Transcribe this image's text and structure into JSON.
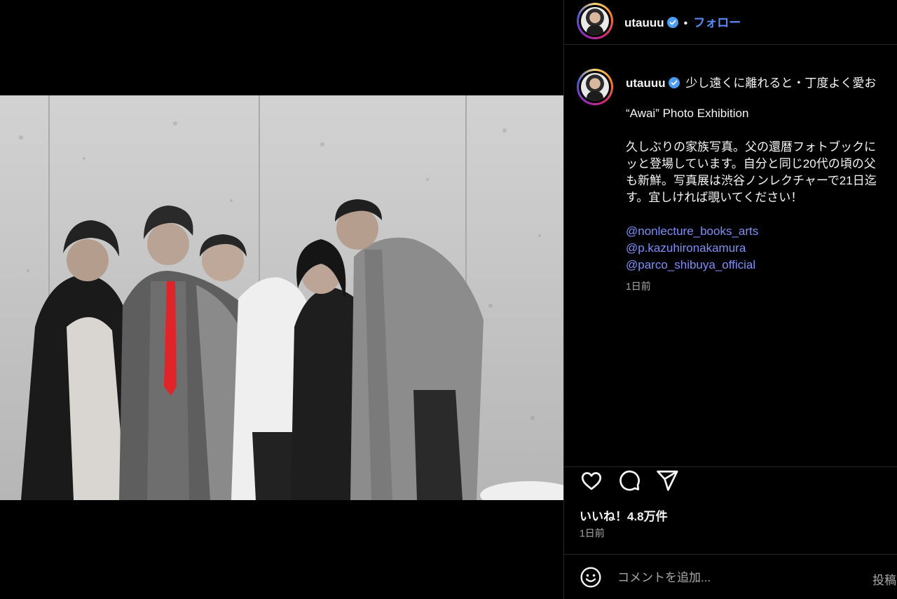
{
  "header": {
    "username": "utauuu",
    "separator": "•",
    "follow_label": "フォロー"
  },
  "post": {
    "username": "utauuu",
    "title_line": "少し遠くに離れると・丁度よく愛お",
    "lines": [
      "“Awai” Photo Exhibition",
      "",
      "久しぶりの家族写真。父の還暦フォトブックに",
      "ッと登場しています。自分と同じ20代の頃の父",
      "も新鮮。写真展は渋谷ノンレクチャーで21日迄",
      "す。宜しければ覗いてください！"
    ],
    "mentions": [
      "@nonlecture_books_arts",
      "@p.kazuhironakamura",
      "@parco_shibuya_official"
    ],
    "time": "1日前"
  },
  "actions": {
    "like_icon": "heart-icon",
    "comment_icon": "comment-icon",
    "share_icon": "send-icon"
  },
  "likes_label": "いいね！4.8万件",
  "date_label": "1日前",
  "comment": {
    "emoji_icon": "smile-icon",
    "placeholder": "コメントを追加...",
    "post_label": "投稿"
  },
  "colors": {
    "accent_blue": "#5b8cf8",
    "mention": "#7f8ff7",
    "verified": "#4b9cf5",
    "tie_red": "#e0252a",
    "background": "#000000",
    "secondary_text": "#a8a8a8"
  }
}
